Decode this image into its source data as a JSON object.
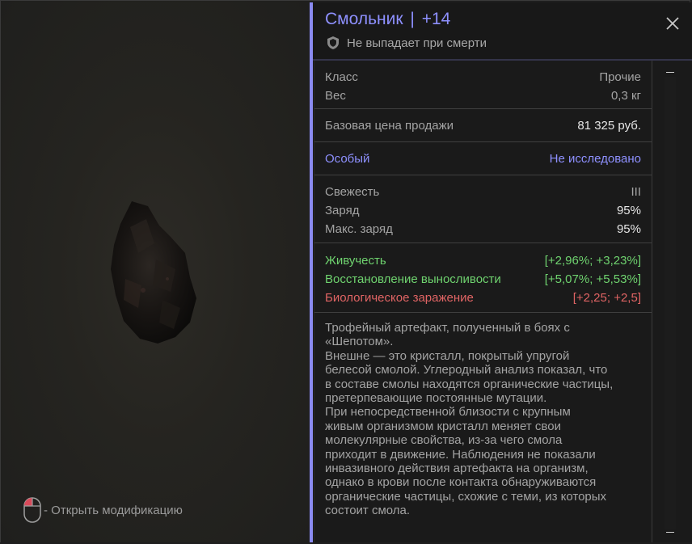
{
  "item": {
    "name": "Смольник",
    "separator": "|",
    "level": "+14",
    "flag": "Не выпадает при смерти"
  },
  "hint": {
    "text": "- Открыть модификацию",
    "icon": "mouse-icon"
  },
  "stats": {
    "class_label": "Класс",
    "class_value": "Прочие",
    "weight_label": "Вес",
    "weight_value": "0,3 кг",
    "price_label": "Базовая цена продажи",
    "price_value": "81 325 руб.",
    "special_label": "Особый",
    "special_value": "Не исследовано",
    "freshness_label": "Свежесть",
    "freshness_value": "III",
    "charge_label": "Заряд",
    "charge_value": "95%",
    "maxcharge_label": "Макс. заряд",
    "maxcharge_value": "95%"
  },
  "effects": [
    {
      "label": "Живучесть",
      "value": "[+2,96%; +3,23%]",
      "color": "#6fd36f"
    },
    {
      "label": "Восстановление выносливости",
      "value": "[+5,07%; +5,53%]",
      "color": "#6fd36f"
    },
    {
      "label": "Биологическое заражение",
      "value": "[+2,25; +2,5]",
      "color": "#e06464"
    }
  ],
  "description": [
    "Трофейный артефакт, полученный в боях с",
    "«Шепотом».",
    "Внешне — это кристалл, покрытый упругой",
    "белесой смолой. Углеродный анализ показал, что",
    "в составе смолы находятся органические частицы,",
    "претерпевающие постоянные мутации.",
    "При непосредственной близости с крупным",
    "живым организмом кристалл меняет свои",
    "молекулярные свойства, из-за чего смола",
    "приходит в движение. Наблюдения не показали",
    "инвазивного действия артефакта на организм,",
    "однако в крови после контакта обнаруживаются",
    "органические частицы, схожие с теми, из которых",
    "состоит смола."
  ],
  "colors": {
    "accent": "#8e90ff",
    "positive": "#6fd36f",
    "negative": "#e06464"
  }
}
